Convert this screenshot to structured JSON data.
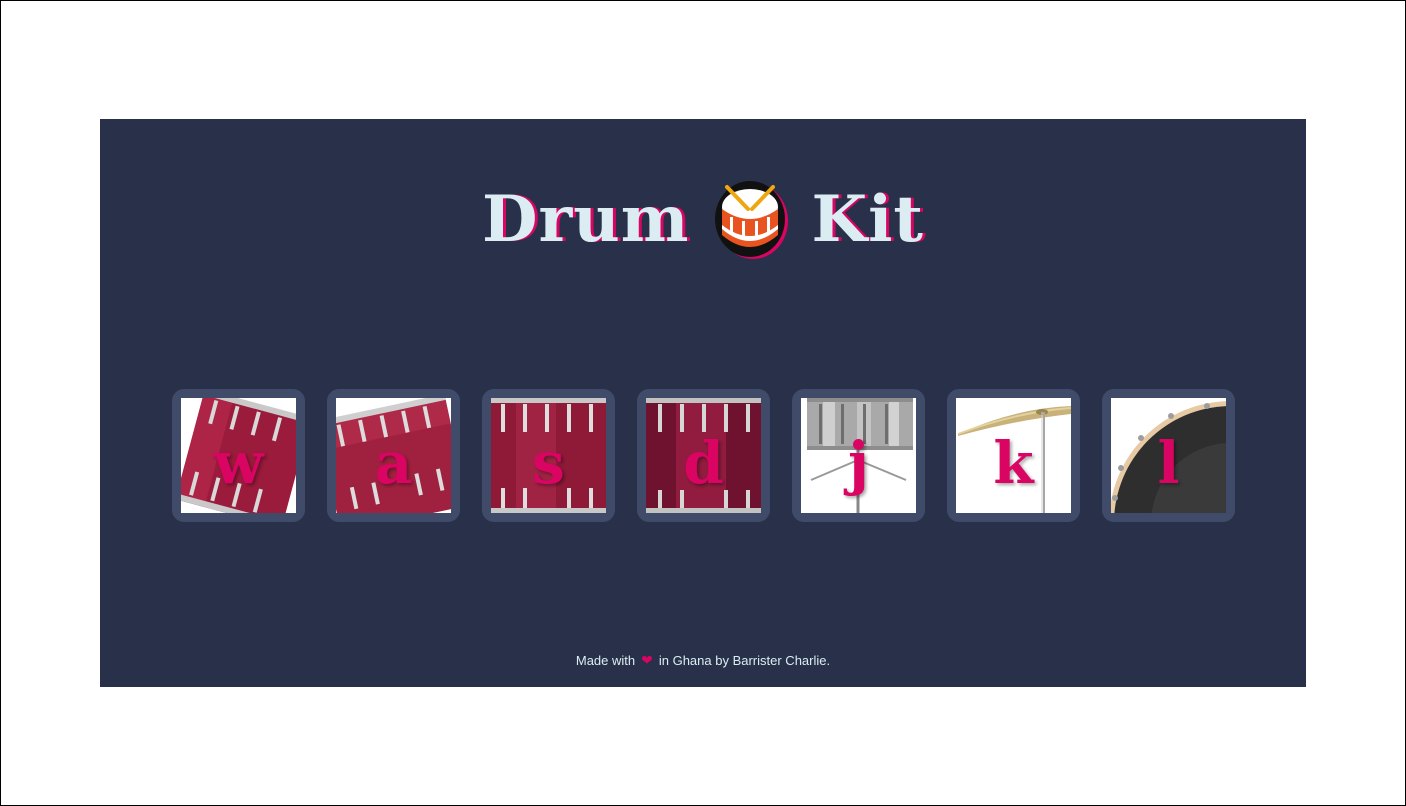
{
  "header": {
    "title_left": "Drum",
    "title_right": "Kit",
    "emoji_icon": "drum-icon"
  },
  "colors": {
    "background": "#283149",
    "key_frame": "#404b69",
    "accent": "#da0463",
    "title_text": "#dbedf3"
  },
  "keys": [
    {
      "letter": "w",
      "instrument": "tom-1"
    },
    {
      "letter": "a",
      "instrument": "tom-2"
    },
    {
      "letter": "s",
      "instrument": "tom-3"
    },
    {
      "letter": "d",
      "instrument": "tom-4"
    },
    {
      "letter": "j",
      "instrument": "snare"
    },
    {
      "letter": "k",
      "instrument": "crash"
    },
    {
      "letter": "l",
      "instrument": "kick"
    }
  ],
  "footer": {
    "prefix": "Made with",
    "heart_icon": "heart-icon",
    "suffix": "in Ghana by Barrister Charlie."
  }
}
